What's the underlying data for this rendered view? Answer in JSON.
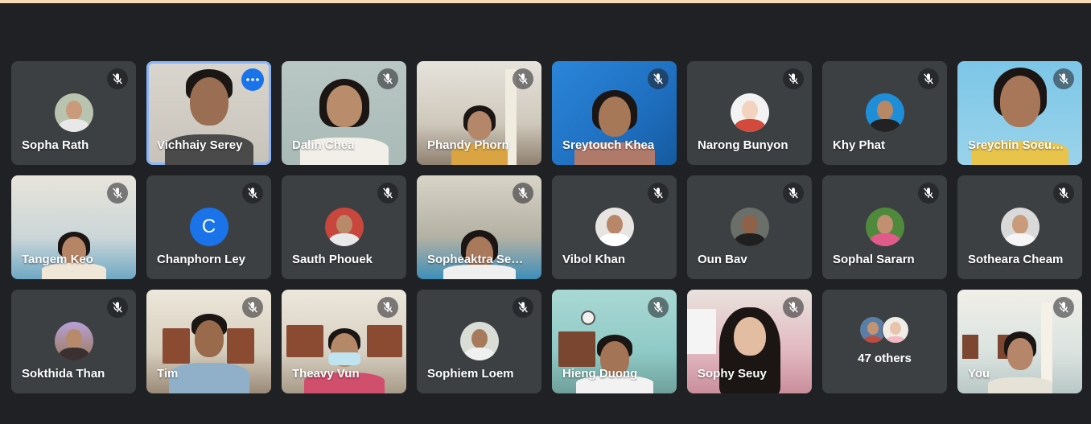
{
  "meeting": {
    "others_count_label": "47 others",
    "colors": {
      "background": "#202124",
      "tile": "#3c4043",
      "accent_blue": "#1a73e8",
      "active_border": "#8ab4f8"
    }
  },
  "participants": [
    {
      "name": "Sopha Rath",
      "type": "photo-avatar",
      "muted": true
    },
    {
      "name": "Vichhaiy Serey",
      "type": "video",
      "muted": false,
      "active": true
    },
    {
      "name": "Dalin Chea",
      "type": "video",
      "muted": true
    },
    {
      "name": "Phandy Phorn",
      "type": "video",
      "muted": true
    },
    {
      "name": "Sreytouch Khea",
      "type": "video",
      "muted": true
    },
    {
      "name": "Narong Bunyon",
      "type": "photo-avatar",
      "muted": true
    },
    {
      "name": "Khy Phat",
      "type": "photo-avatar",
      "muted": true
    },
    {
      "name": "Sreychin Soeu…",
      "type": "video",
      "muted": true
    },
    {
      "name": "Tangem Keo",
      "type": "video",
      "muted": true
    },
    {
      "name": "Chanphorn Ley",
      "type": "letter-avatar",
      "letter": "C",
      "muted": true
    },
    {
      "name": "Sauth Phouek",
      "type": "photo-avatar",
      "muted": true
    },
    {
      "name": "Sopheaktra Se…",
      "type": "video",
      "muted": true
    },
    {
      "name": "Vibol Khan",
      "type": "photo-avatar",
      "muted": true
    },
    {
      "name": "Oun Bav",
      "type": "photo-avatar",
      "muted": true
    },
    {
      "name": "Sophal Sararn",
      "type": "photo-avatar",
      "muted": true
    },
    {
      "name": "Sotheara Cheam",
      "type": "photo-avatar",
      "muted": true
    },
    {
      "name": "Sokthida Than",
      "type": "photo-avatar",
      "muted": true
    },
    {
      "name": "Tim",
      "type": "video",
      "muted": true
    },
    {
      "name": "Theavy Vun",
      "type": "video",
      "muted": true
    },
    {
      "name": "Sophiem Loem",
      "type": "photo-avatar",
      "muted": true
    },
    {
      "name": "Hieng Duong",
      "type": "video",
      "muted": true
    },
    {
      "name": "Sophy Seuy",
      "type": "video",
      "muted": true
    },
    {
      "name": "47 others",
      "type": "others",
      "muted": false
    },
    {
      "name": "You",
      "type": "video",
      "muted": true
    }
  ]
}
